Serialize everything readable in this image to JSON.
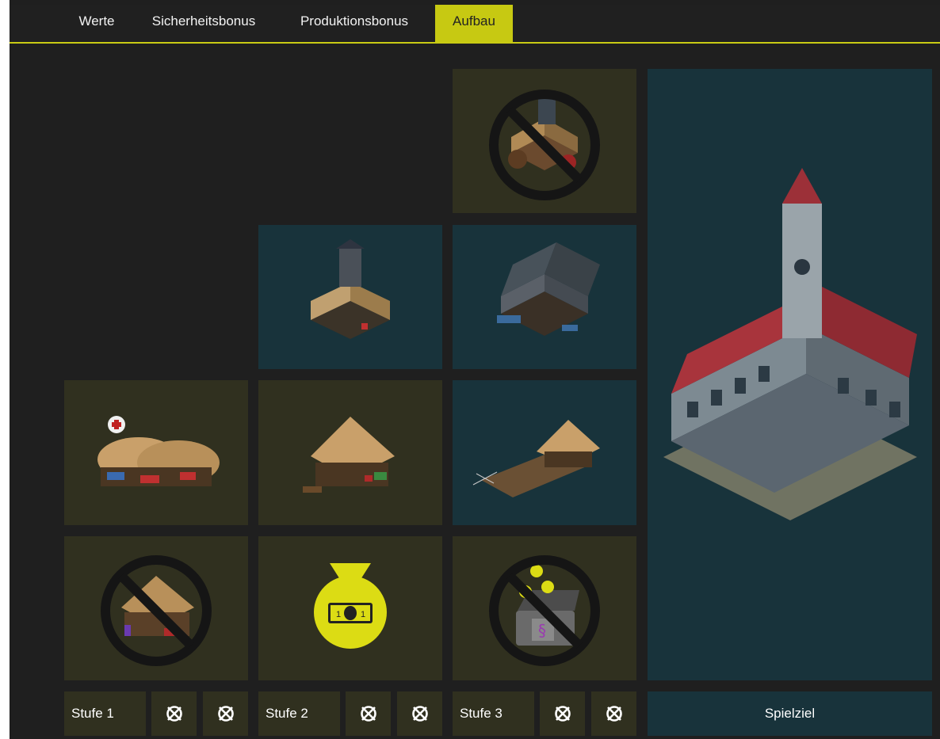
{
  "tabs": [
    {
      "label": "Werte",
      "active": false
    },
    {
      "label": "Sicherheitsbonus",
      "active": false
    },
    {
      "label": "Produktionsbonus",
      "active": false
    },
    {
      "label": "Aufbau",
      "active": true
    }
  ],
  "colors": {
    "accent": "#c7c912",
    "tile_olive": "#30301f",
    "tile_teal": "#18333b",
    "background": "#1f1f1f"
  },
  "tiles": {
    "row1_col3": {
      "icon": "crossed-out-workshop-building-icon",
      "style": "olive"
    },
    "row2_col2": {
      "icon": "watchtower-house-icon",
      "style": "teal"
    },
    "row2_col3": {
      "icon": "market-stall-building-icon",
      "style": "teal"
    },
    "row3_col1": {
      "icon": "healer-hut-icon",
      "style": "olive"
    },
    "row3_col2": {
      "icon": "thatched-cottage-icon",
      "style": "olive"
    },
    "row3_col4": {
      "icon": "fishing-dock-hut-icon",
      "style": "teal"
    },
    "row4_col1": {
      "icon": "crossed-out-house-icon",
      "style": "olive"
    },
    "row4_col2": {
      "icon": "money-bag-icon",
      "style": "olive"
    },
    "row4_col3": {
      "icon": "crossed-out-treasure-chest-icon",
      "style": "olive"
    },
    "town_hall": {
      "icon": "town-hall-icon",
      "style": "teal"
    }
  },
  "footer": {
    "levels": [
      {
        "label": "Stufe 1",
        "markers": [
          "crossed-circle-icon",
          "crossed-circle-icon"
        ]
      },
      {
        "label": "Stufe 2",
        "markers": [
          "crossed-circle-icon",
          "crossed-circle-icon"
        ]
      },
      {
        "label": "Stufe 3",
        "markers": [
          "crossed-circle-icon",
          "crossed-circle-icon"
        ]
      }
    ],
    "goal_label": "Spielziel",
    "marker_symbol": "⦻"
  }
}
